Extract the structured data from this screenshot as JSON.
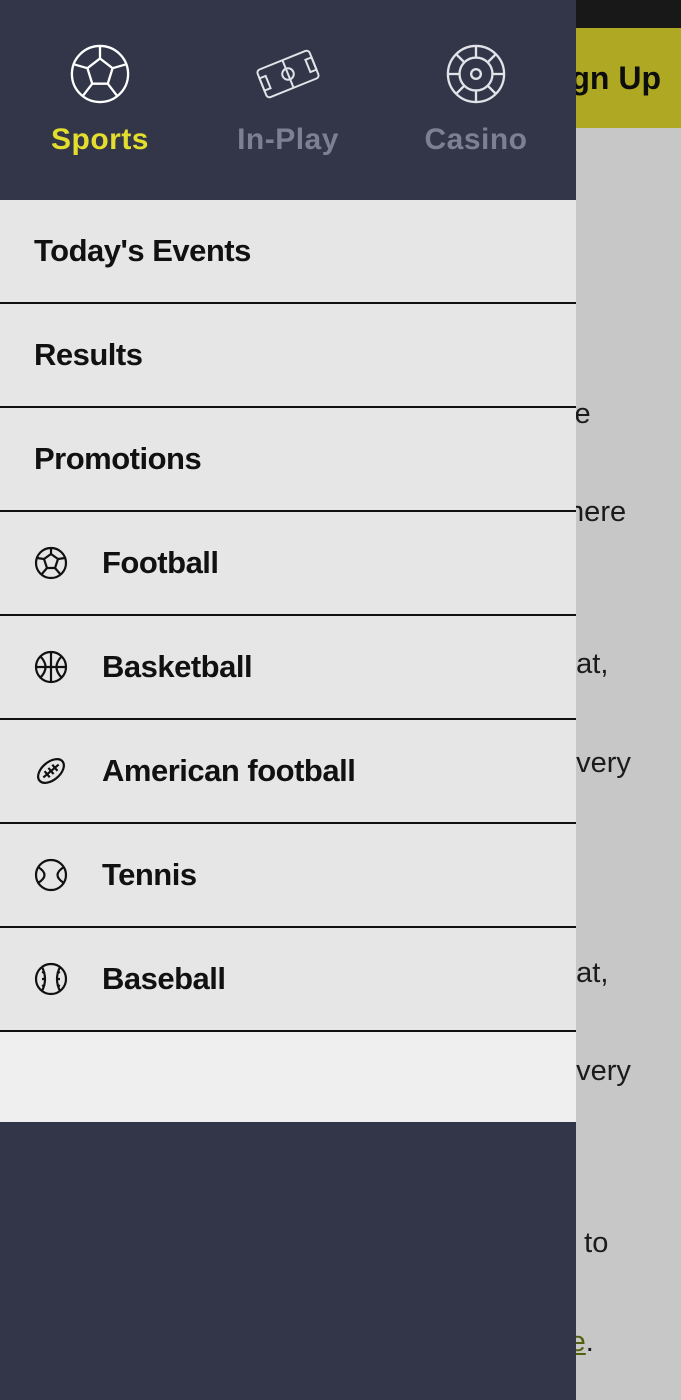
{
  "header": {
    "signup_label": "Sign Up"
  },
  "drawer": {
    "tabs": [
      {
        "label": "Sports",
        "active": true
      },
      {
        "label": "In-Play",
        "active": false
      },
      {
        "label": "Casino",
        "active": false
      }
    ],
    "quick_links": [
      {
        "label": "Today's Events"
      },
      {
        "label": "Results"
      },
      {
        "label": "Promotions"
      }
    ],
    "sports": [
      {
        "label": "Football",
        "icon": "football-icon"
      },
      {
        "label": "Basketball",
        "icon": "basketball-icon"
      },
      {
        "label": "American football",
        "icon": "american-football-icon"
      },
      {
        "label": "Tennis",
        "icon": "tennis-icon"
      },
      {
        "label": "Baseball",
        "icon": "baseball-icon"
      }
    ]
  },
  "background": {
    "fragments": [
      "ve",
      "there",
      "nat,",
      "every",
      ".",
      "nat,",
      "every",
      "d to"
    ],
    "link_text": "re"
  }
}
